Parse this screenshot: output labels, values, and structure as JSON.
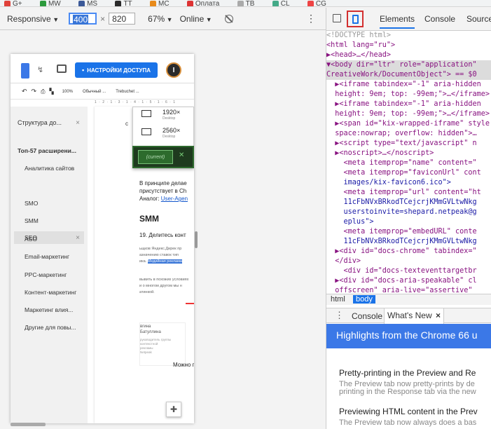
{
  "bookmarks": [
    "G+",
    "MW",
    "MS",
    "TT",
    "MC",
    "Оплата",
    "TB",
    "CL",
    "CG"
  ],
  "device_toolbar": {
    "device": "Responsive",
    "width": "400",
    "times": "×",
    "height": "820",
    "zoom": "67%",
    "throttle": "Online",
    "more": "⋮"
  },
  "doc": {
    "share_label": "НАСТРОЙКИ ДОСТУПА",
    "avatar_letter": "I",
    "toolbar": {
      "zoom": "100%",
      "style": "Обычный ...",
      "font": "Trebuchet ..."
    },
    "ruler": "1 · 2 · 1 · 3 · 1 · 4 · 1 · 5 · 1 · 6 · 1",
    "outline": {
      "header": "Структура до...",
      "items": [
        "Топ-57 расширени...",
        "Аналитика сайтов",
        "SEO",
        "SMO",
        "SMM",
        "ASO",
        "Email-маркетинг",
        "PPC-маркетинг",
        "Контент-маркетинг",
        "Маркетинг влия...",
        "Другие для повы..."
      ]
    },
    "popup": {
      "res1": "1920×",
      "res1_sub": "Desktop",
      "res2": "2560×",
      "res2_sub": "Desktop",
      "current": "(current)"
    },
    "text": {
      "p1a": "В принципе делае",
      "p1b": "присутствует в Ch",
      "p1c": "Аналог: ",
      "p1c_link": "User-Agen",
      "heading": "SMM",
      "p2": "19. Делитесь конт",
      "s1": "ьщков Яндекс.Дирек пр",
      "s2": "азначению ставок тип",
      "s3": "ика. ",
      "s3_hl": "Медийная реклама",
      "s4": "вывить в похожих условиях",
      "s5": "и о многом другом мы н",
      "s6": "атинкой.",
      "c1": "вгина",
      "c2": "Батуллина",
      "c3": "руководитель группы",
      "c4": "контекстной",
      "c5": "рекламы",
      "c6": "Netpeak",
      "tail": "Можно п"
    }
  },
  "devtools": {
    "tabs": [
      "Elements",
      "Console",
      "Sources"
    ],
    "dom": [
      "<!DOCTYPE html>",
      "<html lang=\"ru\">",
      "▶<head>…</head>",
      "▼<body dir=\"ltr\" role=\"application\"",
      "CreativeWork/DocumentObject\"> == $0",
      "  ▶<iframe tabindex=\"-1\" aria-hidden",
      "  height: 9em; top: -99em;\">…</iframe>",
      "  ▶<iframe tabindex=\"-1\" aria-hidden",
      "  height: 9em; top: -99em;\">…</iframe>",
      "  ▶<span id=\"kix-wrapped-iframe\" style",
      "  space:nowrap; overflow: hidden\">…",
      "  ▶<script type=\"text/javascript\" n",
      "  ▶<noscript>…</noscript>",
      "    <meta itemprop=\"name\" content=\"",
      "    <meta itemprop=\"faviconUrl\" cont",
      "    images/kix-favicon6.ico\">",
      "    <meta itemprop=\"url\" content=\"ht",
      "    11cFbNVxBRkodTCejcrjKMmGVLtwNkg",
      "    userstoinvite=shepard.netpeak@g",
      "    eplus\">",
      "    <meta itemprop=\"embedURL\" conte",
      "    11cFbNVxBRkodTCejcrjKMmGVLtwNkg",
      "  ▶<div id=\"docs-chrome\" tabindex=\"",
      "  </div>",
      "    <div id=\"docs-texteventtargetbr",
      "  ▶<div id=\"docs-aria-speakable\" cl",
      "  offscreen\" aria-live=\"assertive\""
    ],
    "breadcrumbs": [
      "html",
      "body"
    ],
    "drawer_tabs": {
      "console": "Console",
      "whatsnew": "What's New",
      "close": "×"
    },
    "banner": "Highlights from the Chrome 66 u",
    "whatsnew": {
      "h1": "Pretty-printing in the Preview and Re",
      "p1a": "The Preview tab now pretty-prints by de",
      "p1b": "printing in the Response tab via the new",
      "h2": "Previewing HTML content in the Prev",
      "p2a": "The Preview tab now always does a bas"
    }
  }
}
